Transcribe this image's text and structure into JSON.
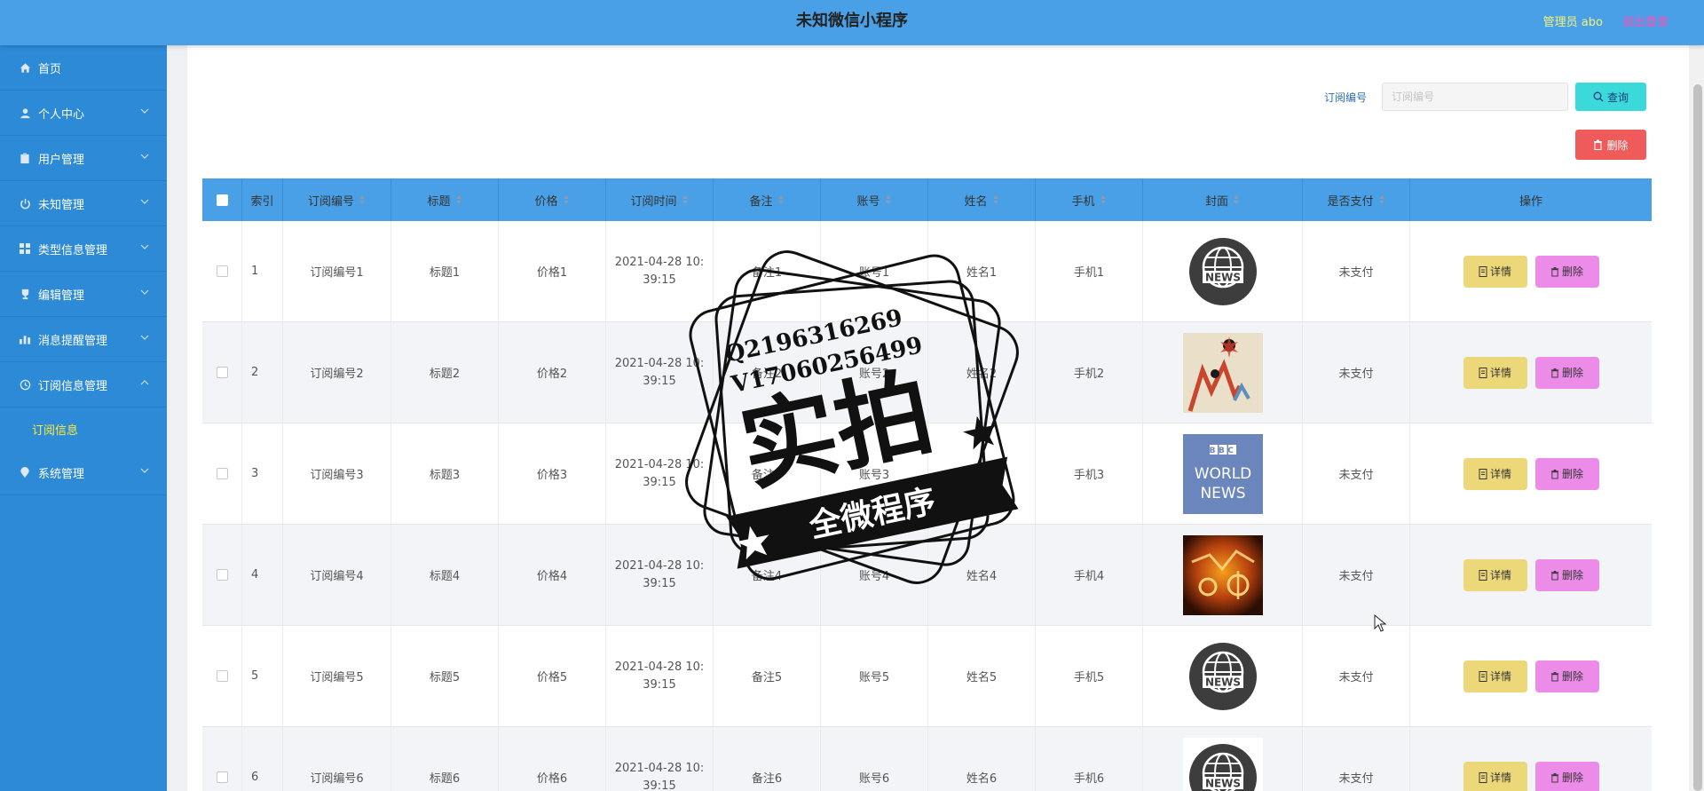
{
  "header": {
    "title": "未知微信小程序",
    "user_label": "管理员 abo",
    "logout_label": "退出登录"
  },
  "sidebar": {
    "items": [
      {
        "label": "首页",
        "icon": "home-icon"
      },
      {
        "label": "个人中心",
        "icon": "user-icon"
      },
      {
        "label": "用户管理",
        "icon": "clipboard-icon"
      },
      {
        "label": "未知管理",
        "icon": "power-icon"
      },
      {
        "label": "类型信息管理",
        "icon": "grid-icon"
      },
      {
        "label": "编辑管理",
        "icon": "trophy-icon"
      },
      {
        "label": "消息提醒管理",
        "icon": "bar-chart-icon"
      },
      {
        "label": "订阅信息管理",
        "icon": "clock-icon"
      },
      {
        "label": "系统管理",
        "icon": "location-icon"
      }
    ],
    "active_sub": "订阅信息"
  },
  "toolbar": {
    "search_label": "订阅编号",
    "search_placeholder": "订阅编号",
    "query_label": "查询",
    "delete_label": "删除"
  },
  "table": {
    "headers": [
      "索引",
      "订阅编号",
      "标题",
      "价格",
      "订阅时间",
      "备注",
      "账号",
      "姓名",
      "手机",
      "封面",
      "是否支付",
      "操作"
    ],
    "rows": [
      {
        "index": "1",
        "code": "订阅编号1",
        "title": "标题1",
        "price": "价格1",
        "time1": "2021-04-28 10:",
        "time2": "39:15",
        "note": "备注1",
        "account": "账号1",
        "name": "姓名1",
        "phone": "手机1",
        "cover": "news-globe",
        "paid": "未支付"
      },
      {
        "index": "2",
        "code": "订阅编号2",
        "title": "标题2",
        "price": "价格2",
        "time1": "2021-04-28 10:",
        "time2": "39:15",
        "note": "备注2",
        "account": "账号2",
        "name": "姓名2",
        "phone": "手机2",
        "cover": "stock-chart",
        "paid": "未支付"
      },
      {
        "index": "3",
        "code": "订阅编号3",
        "title": "标题3",
        "price": "价格3",
        "time1": "2021-04-28 10:",
        "time2": "39:15",
        "note": "备注3",
        "account": "账号3",
        "name": "姓名3",
        "phone": "手机3",
        "cover": "bbc-world-news",
        "paid": "未支付"
      },
      {
        "index": "4",
        "code": "订阅编号4",
        "title": "标题4",
        "price": "价格4",
        "time1": "2021-04-28 10:",
        "time2": "39:15",
        "note": "备注4",
        "account": "账号4",
        "name": "姓名4",
        "phone": "手机4",
        "cover": "finance-image",
        "paid": "未支付"
      },
      {
        "index": "5",
        "code": "订阅编号5",
        "title": "标题5",
        "price": "价格5",
        "time1": "2021-04-28 10:",
        "time2": "39:15",
        "note": "备注5",
        "account": "账号5",
        "name": "姓名5",
        "phone": "手机5",
        "cover": "news-globe",
        "paid": "未支付"
      },
      {
        "index": "6",
        "code": "订阅编号6",
        "title": "标题6",
        "price": "价格6",
        "time1": "2021-04-28 10:",
        "time2": "39:15",
        "note": "备注6",
        "account": "账号6",
        "name": "姓名6",
        "phone": "手机6",
        "cover": "news-globe",
        "paid": "未支付"
      }
    ],
    "detail_label": "详情",
    "delete_label": "删除"
  },
  "cover_text": {
    "news": "NEWS",
    "bbc": "BBC",
    "world": "WORLD",
    "news2": "NEWS"
  },
  "watermark": {
    "line1": "Q2196316269",
    "line2": "V17060256499",
    "big": "实拍",
    "ribbon": "全微程序"
  },
  "colors": {
    "header_bg": "#4aa0e6",
    "sidebar_bg": "#2d8ad6",
    "detail_btn": "#ecd878",
    "delete_btn": "#ec8ce8",
    "delete_main_btn": "#ef5b5b",
    "query_btn": "#3bd9d9"
  }
}
